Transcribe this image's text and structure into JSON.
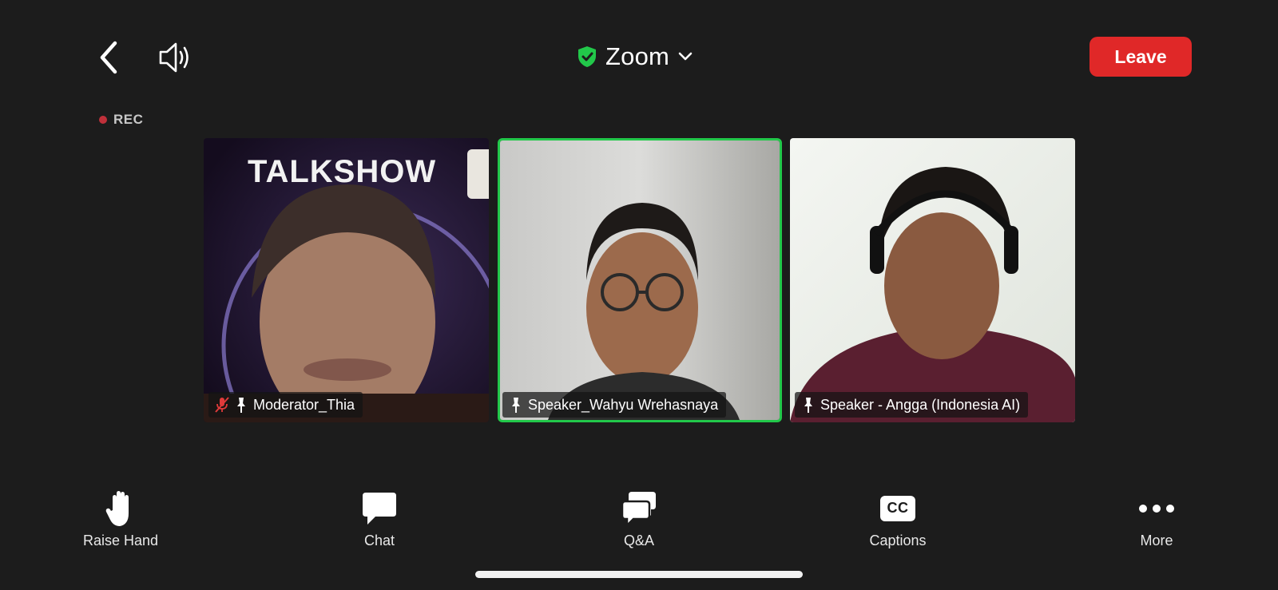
{
  "header": {
    "back_icon": "chevron-left-icon",
    "audio_icon": "speaker-icon",
    "app_title": "Zoom",
    "security_icon": "shield-check-icon",
    "security_color": "#22c84a",
    "dropdown_icon": "chevron-down-icon",
    "leave_label": "Leave",
    "leave_color": "#e02828"
  },
  "recording": {
    "label": "REC",
    "dot_color": "#c0303a"
  },
  "participants": [
    {
      "name": "Moderator_Thia",
      "muted": true,
      "pinned": true,
      "active_speaker": false,
      "background_text": "TALKSHOW"
    },
    {
      "name": "Speaker_Wahyu Wrehasnaya",
      "muted": false,
      "pinned": true,
      "active_speaker": true
    },
    {
      "name": "Speaker - Angga (Indonesia AI)",
      "muted": false,
      "pinned": true,
      "active_speaker": false
    }
  ],
  "toolbar": {
    "raise_hand": "Raise Hand",
    "chat": "Chat",
    "qa": "Q&A",
    "captions": "Captions",
    "captions_glyph": "CC",
    "more": "More"
  },
  "active_speaker_color": "#22c84a"
}
